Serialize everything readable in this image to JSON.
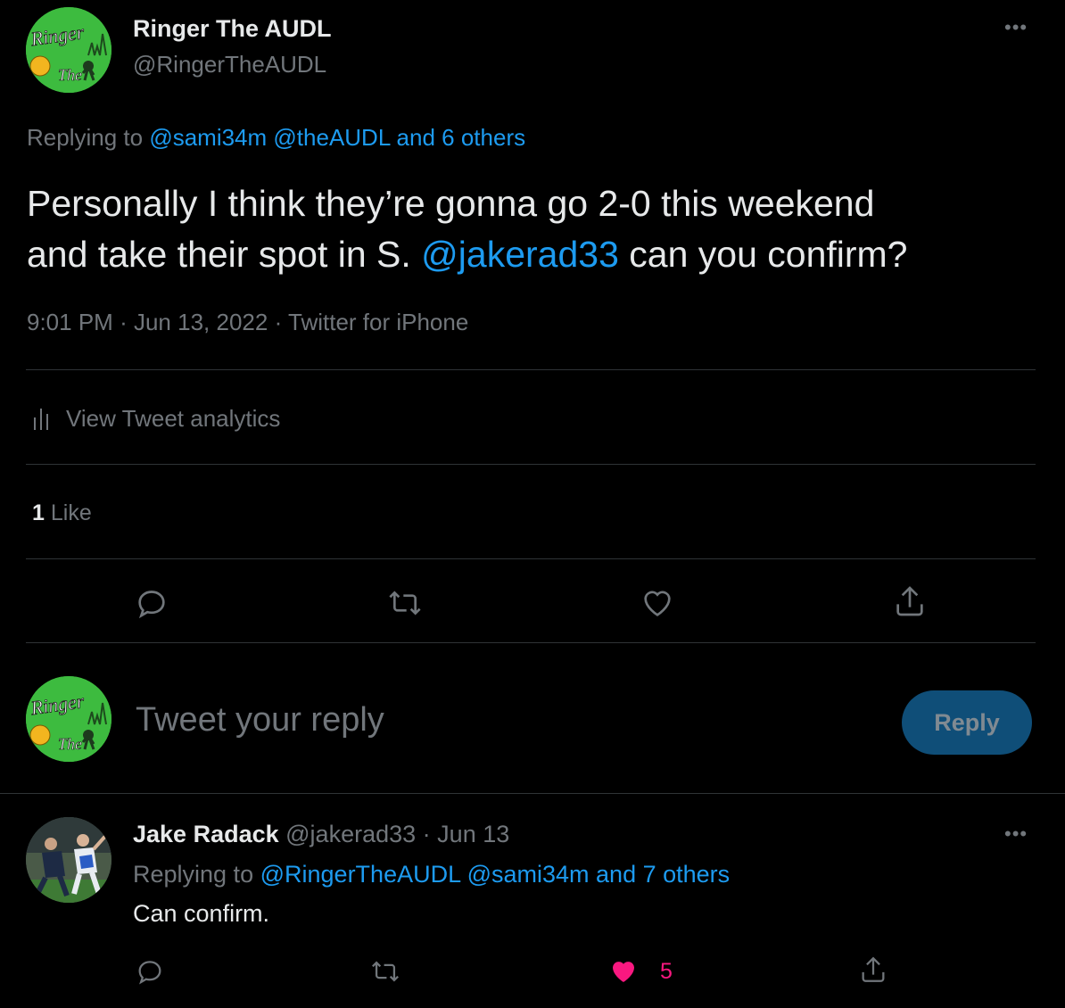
{
  "main_tweet": {
    "author_name": "Ringer The AUDL",
    "author_handle": "@RingerTheAUDL",
    "avatar_text_top": "Ringer",
    "avatar_text_bottom": "The",
    "replying_prefix": "Replying to",
    "replying_users": "@sami34m @theAUDL and 6 others",
    "text_line1": "Personally I think they’re gonna go 2-0 this weekend",
    "text_line2_before": "and take their spot in S.",
    "text_mention": "@jakerad33",
    "text_line2_after": "can you confirm?",
    "time": "9:01 PM",
    "date": "Jun 13, 2022",
    "source": "Twitter for iPhone",
    "separator": "·",
    "analytics_label": "View Tweet analytics",
    "like_count": "1",
    "like_label": "Like",
    "more_icon": "more-horizontal-icon"
  },
  "composer": {
    "placeholder": "Tweet your reply",
    "reply_button": "Reply",
    "avatar_text_top": "Ringer",
    "avatar_text_bottom": "The"
  },
  "reply_tweet": {
    "author_name": "Jake Radack",
    "author_handle": "@jakerad33",
    "separator": "·",
    "date": "Jun 13",
    "replying_prefix": "Replying to",
    "replying_users": "@RingerTheAUDL @sami34m and 7 others",
    "text": "Can confirm.",
    "like_count": "5"
  },
  "colors": {
    "background": "#000000",
    "text": "#e7e9ea",
    "muted": "#71767b",
    "link": "#1d9bf0",
    "liked": "#f91880",
    "reply_button_bg": "#0f4e78",
    "avatar_green": "#3dbb3f"
  }
}
